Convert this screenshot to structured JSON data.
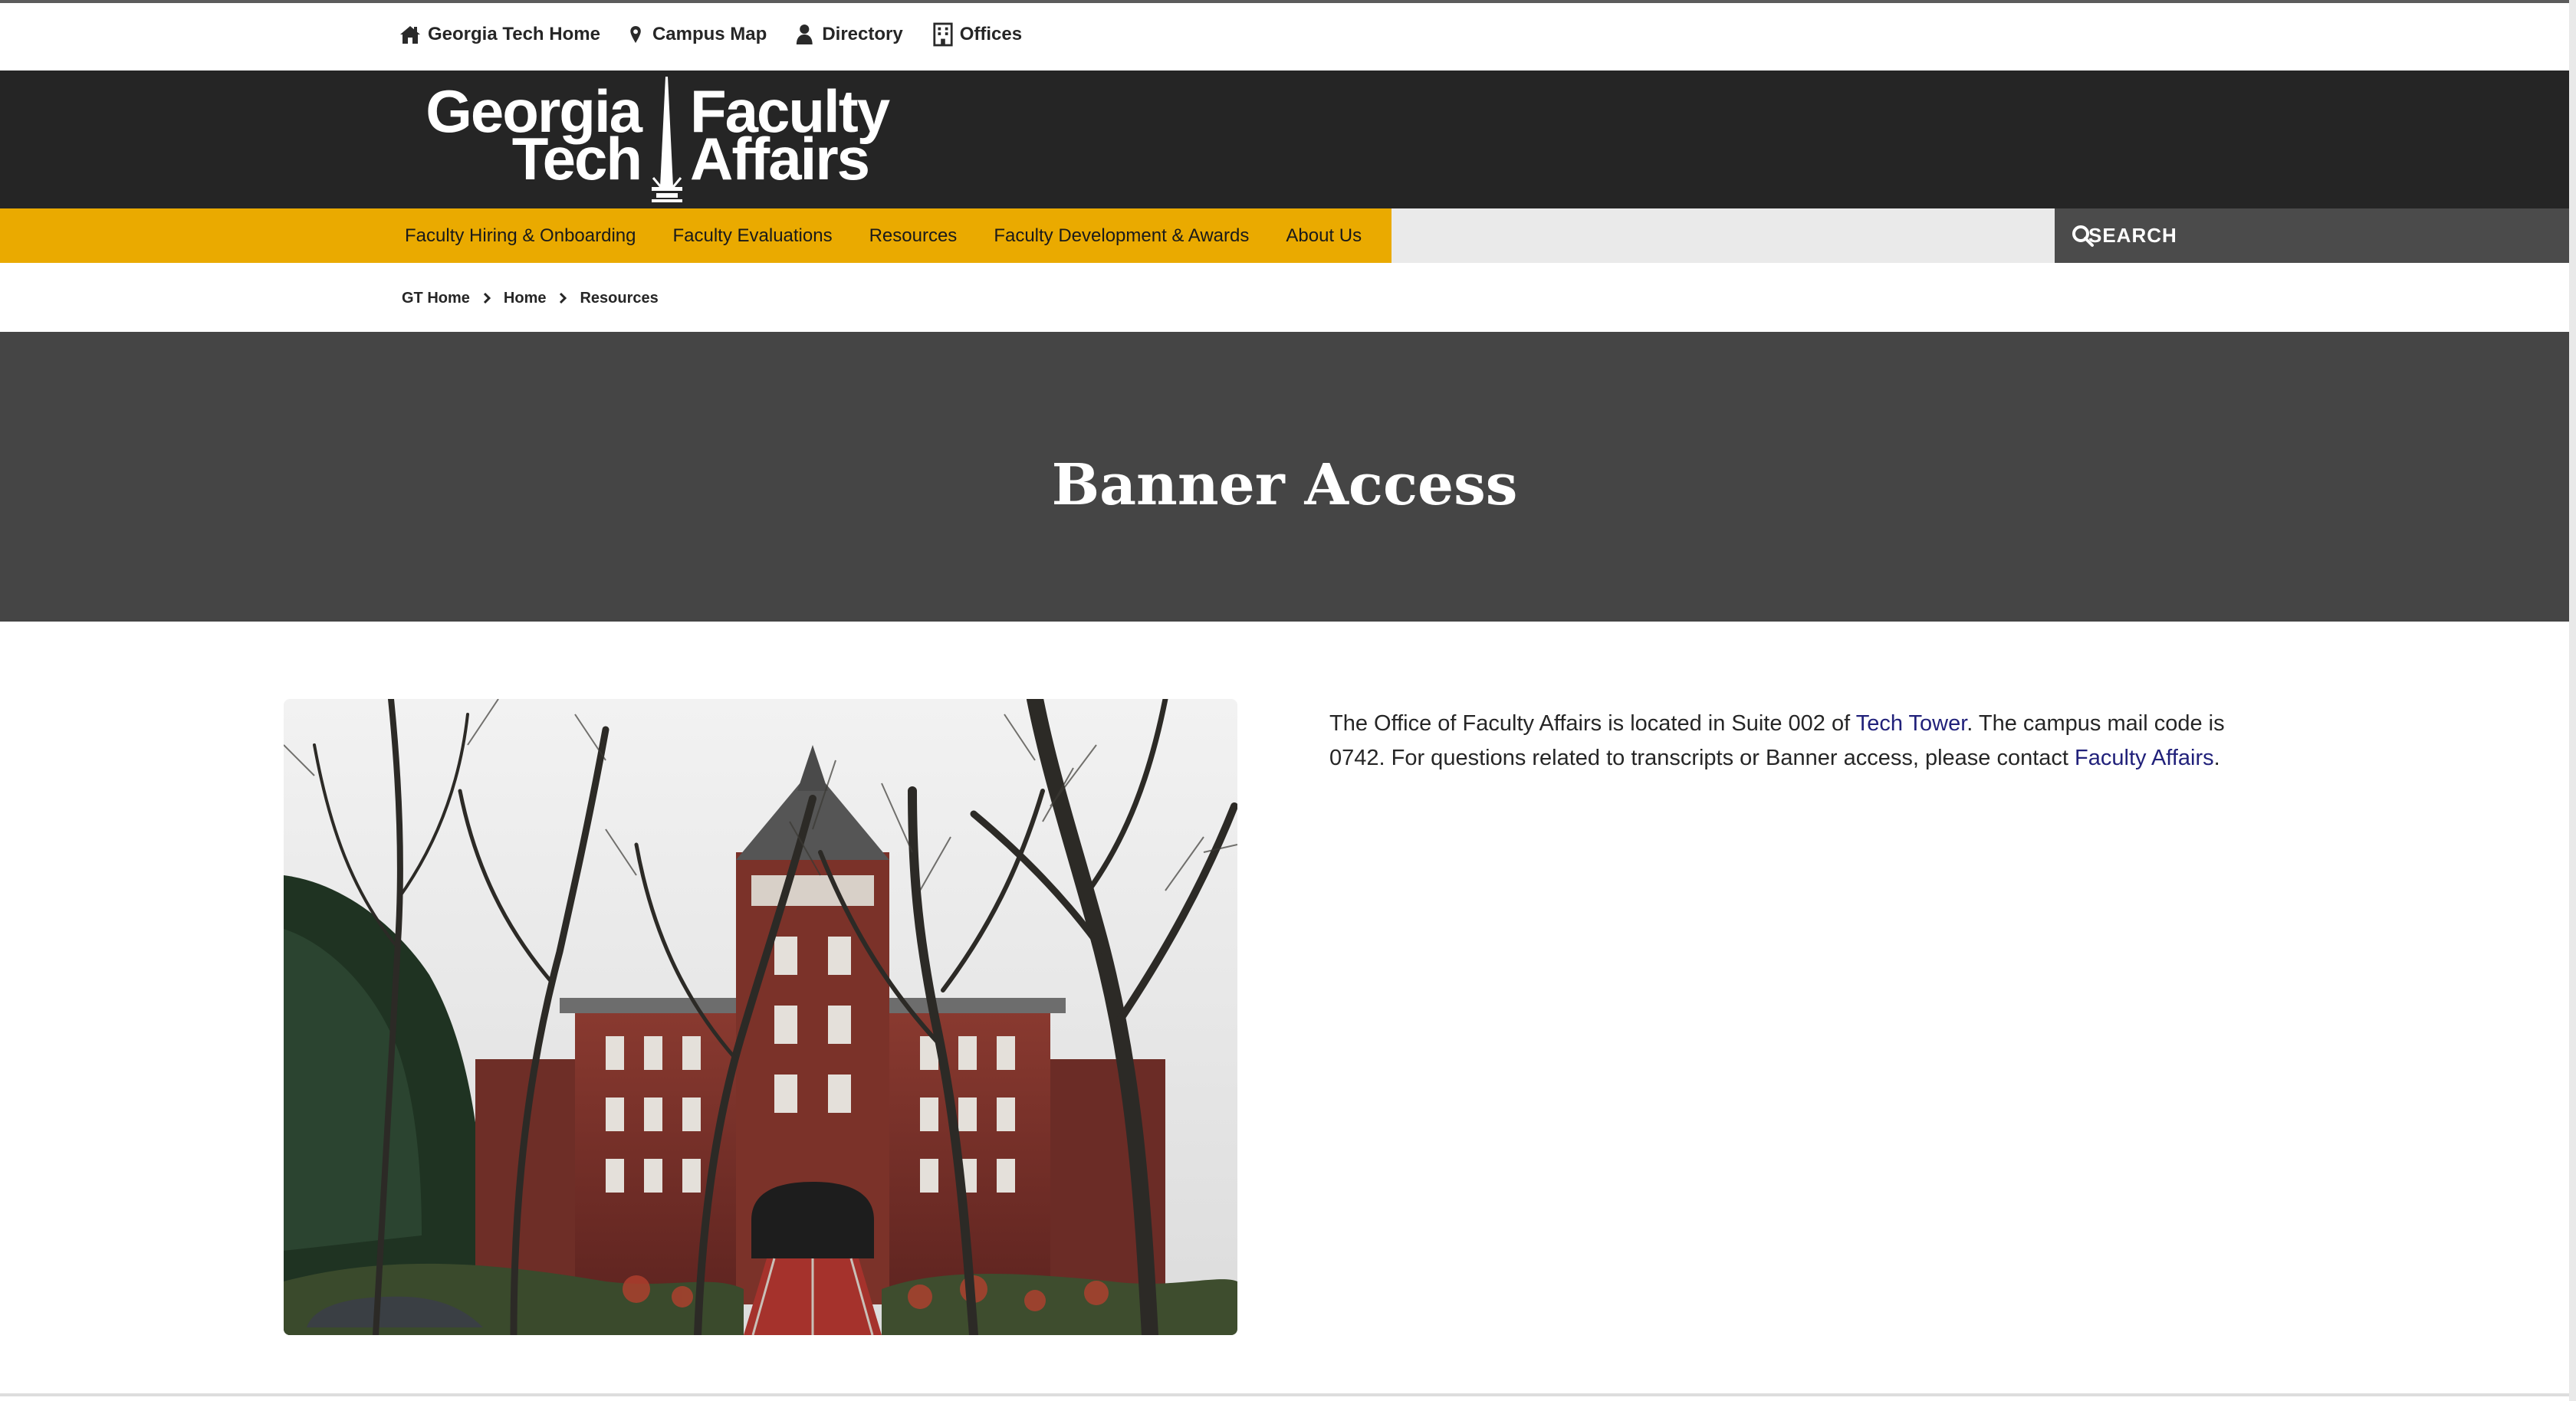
{
  "utility_nav": [
    {
      "label": "Georgia Tech Home",
      "icon": "home-icon"
    },
    {
      "label": "Campus Map",
      "icon": "map-pin-icon"
    },
    {
      "label": "Directory",
      "icon": "person-icon"
    },
    {
      "label": "Offices",
      "icon": "building-icon"
    }
  ],
  "logo": {
    "line1": "Georgia",
    "line2": "Tech",
    "line3": "Faculty",
    "line4": "Affairs"
  },
  "main_nav": [
    {
      "label": "Faculty Hiring & Onboarding"
    },
    {
      "label": "Faculty Evaluations"
    },
    {
      "label": "Resources"
    },
    {
      "label": "Faculty Development & Awards"
    },
    {
      "label": "About Us"
    }
  ],
  "search": {
    "button_label": "SEARCH",
    "value": ""
  },
  "breadcrumb": [
    {
      "label": "GT Home"
    },
    {
      "label": "Home"
    },
    {
      "label": "Resources"
    }
  ],
  "page_title": "Banner Access",
  "content": {
    "p_before_link1": "The Office of Faculty Affairs is located in Suite 002 of ",
    "link1": "Tech Tower",
    "p_between": ". The campus mail code is 0742. For questions related to transcripts or Banner access, please contact ",
    "link2": "Faculty Affairs",
    "p_end": "."
  },
  "colors": {
    "nav_gold": "#eaaa00",
    "header_dark": "#252525",
    "hero_gray": "#454545",
    "link": "#21217a"
  }
}
